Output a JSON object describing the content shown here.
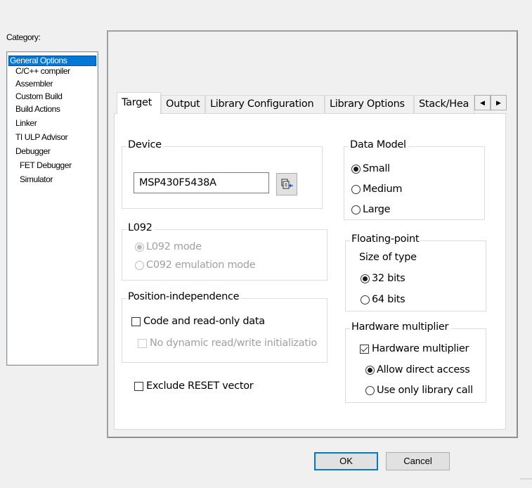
{
  "category": {
    "label": "Category:",
    "items": [
      {
        "label": "General Options",
        "selected": true,
        "indent": 0
      },
      {
        "label": "C/C++ compiler",
        "selected": false,
        "indent": 1
      },
      {
        "label": "Assembler",
        "selected": false,
        "indent": 1
      },
      {
        "label": "Custom Build",
        "selected": false,
        "indent": 1
      },
      {
        "label": "Build Actions",
        "selected": false,
        "indent": 1
      },
      {
        "label": "Linker",
        "selected": false,
        "indent": 1
      },
      {
        "label": "TI ULP Advisor",
        "selected": false,
        "indent": 1
      },
      {
        "label": "Debugger",
        "selected": false,
        "indent": 1
      },
      {
        "label": "FET Debugger",
        "selected": false,
        "indent": 2
      },
      {
        "label": "Simulator",
        "selected": false,
        "indent": 2
      }
    ]
  },
  "tabs": [
    {
      "label": "Target",
      "active": true
    },
    {
      "label": "Output",
      "active": false
    },
    {
      "label": "Library Configuration",
      "active": false
    },
    {
      "label": "Library Options",
      "active": false
    },
    {
      "label": "Stack/Hea",
      "active": false
    }
  ],
  "tab_scroll": {
    "left_icon": "scroll-left-arrow",
    "right_icon": "scroll-right-arrow",
    "left_glyph": "◀",
    "right_glyph": "▶"
  },
  "device": {
    "legend": "Device",
    "value": "MSP430F5438A",
    "select_button_icon": "device-select-icon"
  },
  "l092": {
    "legend": "L092",
    "enabled": false,
    "options": [
      {
        "label": "L092 mode",
        "selected": true
      },
      {
        "label": "C092 emulation mode",
        "selected": false
      }
    ]
  },
  "position_independence": {
    "legend": "Position-independence",
    "code_ro_data": {
      "label": "Code and read-only data",
      "checked": false,
      "enabled": true
    },
    "no_dynamic_rw": {
      "label": "No dynamic read/write initializatio",
      "checked": false,
      "enabled": false
    }
  },
  "exclude_reset": {
    "label": "Exclude RESET vector",
    "checked": false
  },
  "data_model": {
    "legend": "Data Model",
    "options": [
      {
        "label": "Small",
        "selected": true
      },
      {
        "label": "Medium",
        "selected": false
      },
      {
        "label": "Large",
        "selected": false
      }
    ]
  },
  "floating_point": {
    "legend": "Floating-point",
    "size_label": "Size of type",
    "options": [
      {
        "label": "32 bits",
        "selected": true
      },
      {
        "label": "64 bits",
        "selected": false
      }
    ]
  },
  "hardware_multiplier": {
    "legend": "Hardware multiplier",
    "checkbox": {
      "label": "Hardware multiplier",
      "checked": true
    },
    "options": [
      {
        "label": "Allow direct access",
        "selected": true
      },
      {
        "label": "Use only library call",
        "selected": false
      }
    ]
  },
  "buttons": {
    "ok": "OK",
    "cancel": "Cancel"
  },
  "colors": {
    "selection": "#0078d7",
    "default_button_border": "#0078d7"
  }
}
